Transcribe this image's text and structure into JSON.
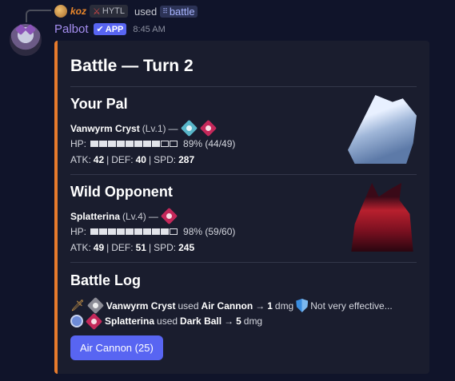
{
  "reply": {
    "username": "koz",
    "guild_tag": "HYTL",
    "used_text": "used",
    "command": "battle"
  },
  "message": {
    "bot_name": "Palbot",
    "app_badge": "APP",
    "timestamp": "8:45 AM"
  },
  "embed": {
    "accent_color": "#e87b2c",
    "title": "Battle — Turn 2",
    "your_pal": {
      "heading": "Your Pal",
      "name": "Vanwyrm Cryst",
      "level": "(Lv.1)",
      "dash": "—",
      "types": [
        "ice-type-icon",
        "dark-type-icon"
      ],
      "hp_label": "HP:",
      "hp_text": "89% (44/49)",
      "hp_filled": 8,
      "hp_total": 10,
      "atk_label": "ATK:",
      "atk": "42",
      "def_label": "DEF:",
      "def": "40",
      "spd_label": "SPD:",
      "spd": "287"
    },
    "wild_opponent": {
      "heading": "Wild Opponent",
      "name": "Splatterina",
      "level": "(Lv.4)",
      "dash": "—",
      "types": [
        "dark-type-icon"
      ],
      "hp_label": "HP:",
      "hp_text": "98% (59/60)",
      "hp_filled": 9,
      "hp_total": 10,
      "atk_label": "ATK:",
      "atk": "49",
      "def_label": "DEF:",
      "def": "51",
      "spd_label": "SPD:",
      "spd": "245"
    },
    "battle_log": {
      "heading": "Battle Log",
      "entries": [
        {
          "actor": "Vanwyrm Cryst",
          "used": "used",
          "move": "Air Cannon",
          "arrow": "→",
          "damage": "1",
          "dmg_label": "dmg",
          "note": "Not very effective..."
        },
        {
          "actor": "Splatterina",
          "used": "used",
          "move": "Dark Ball",
          "arrow": "→",
          "damage": "5",
          "dmg_label": "dmg",
          "note": ""
        }
      ]
    },
    "action_button": "Air Cannon (25)"
  }
}
